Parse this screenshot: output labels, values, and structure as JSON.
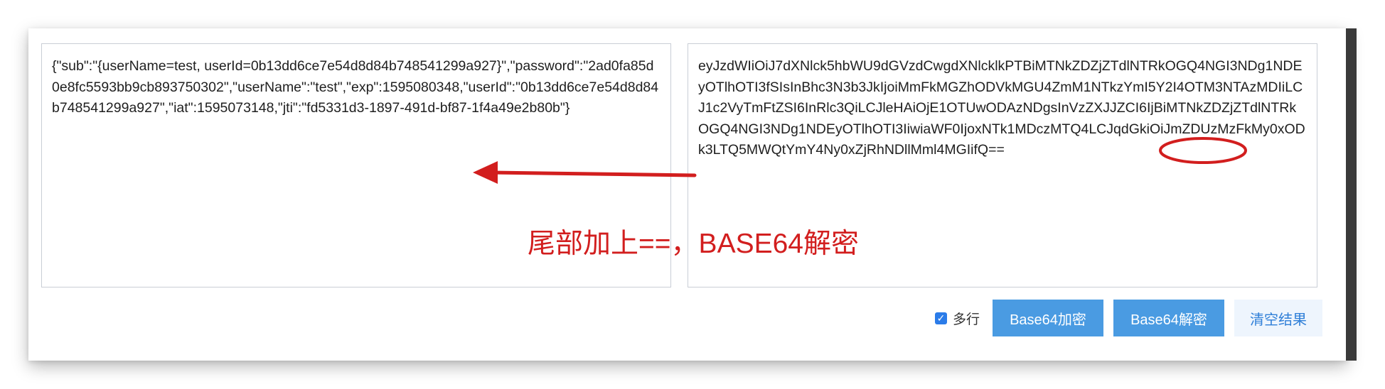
{
  "input_panel": {
    "text": "eyJzdWIiOiJ7dXNlck5hbWU9dGVzdCwgdXNlcklkPTBiMTNkZDZjZTdlNTRkOGQ4NGI3NDg1NDEyOTlhOTI3fSIsInBhc3N3b3JkIjoiMmFkMGZhODVkMGU4ZmM1NTkzYmI5Y2I4OTM3NTAzMDIiLCJ1c2VyTmFtZSI6InRlc3QiLCJleHAiOjE1OTUwODAzNDgsInVzZXJJZCI6IjBiMTNkZDZjZTdlNTRkOGQ4NGI3NDg1NDEyOTlhOTI3IiwiaWF0IjoxNTk1MDczMTQ4LCJqdGkiOiJmZDUzMzFkMy0xODk3LTQ5MWQtYmY4Ny0xZjRhNDllMml4MGIifQ=="
  },
  "output_panel": {
    "text": "{\"sub\":\"{userName=test, userId=0b13dd6ce7e54d8d84b748541299a927}\",\"password\":\"2ad0fa85d0e8fc5593bb9cb893750302\",\"userName\":\"test\",\"exp\":1595080348,\"userId\":\"0b13dd6ce7e54d8d84b748541299a927\",\"iat\":1595073148,\"jti\":\"fd5331d3-1897-491d-bf87-1f4a49e2b80b\"}"
  },
  "annotation": {
    "text": "尾部加上==，BASE64解密",
    "color": "#d21e1e"
  },
  "toolbar": {
    "multiline_label": "多行",
    "multiline_checked": true,
    "encode_label": "Base64加密",
    "decode_label": "Base64解密",
    "clear_label": "清空结果"
  },
  "colors": {
    "primary_button": "#4a9be2",
    "plain_button_bg": "#eef5fd",
    "plain_button_text": "#2f7fd8",
    "checkbox": "#2b7ce9"
  }
}
